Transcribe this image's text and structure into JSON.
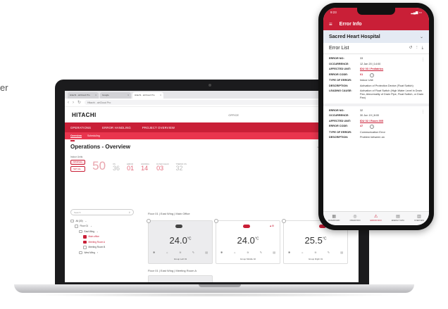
{
  "crop_text": "er",
  "laptop": {
    "browser": {
      "tabs": [
        {
          "label": "Hitachi - airCloud Pro",
          "active": false
        },
        {
          "label": "Google",
          "active": false
        },
        {
          "label": "Hitachi - airCloud Pro",
          "active": true
        }
      ],
      "address": "Hitachi - airCloud Pro"
    },
    "brand": "HITACHI",
    "office_label": "OFFICE",
    "menu": [
      "OPERATIONS",
      "ERROR HANDLING",
      "PROJECT OVERVIEW"
    ],
    "submenu": [
      "Overview",
      "Scheduling"
    ],
    "page_title": "Operations - Overview",
    "last_update": "Last Updated on 10:50 May 20, 2020",
    "indoor_units_label": "Indoor Units",
    "pills": [
      "STOP ALL",
      "SET ALL"
    ],
    "total_units": "50",
    "stats": [
      {
        "label": "ON",
        "value": "36"
      },
      {
        "label": "ERROR",
        "value": "01"
      },
      {
        "label": "WARNING",
        "value": "14"
      },
      {
        "label": "FILTER CLEAN",
        "value": "03"
      },
      {
        "label": "THERMO ON",
        "value": "32"
      }
    ],
    "search_placeholder": "Search",
    "tree": [
      {
        "label": "All (30)",
        "level": 0,
        "checked": false,
        "red": false
      },
      {
        "label": "Floor 01",
        "level": 1,
        "checked": false,
        "red": false
      },
      {
        "label": "East Wing",
        "level": 2,
        "checked": false,
        "red": false
      },
      {
        "label": "Main office",
        "level": 3,
        "checked": true,
        "red": true
      },
      {
        "label": "Meeting Room A",
        "level": 3,
        "checked": true,
        "red": true
      },
      {
        "label": "Meeting Room B",
        "level": 3,
        "checked": false,
        "red": false
      },
      {
        "label": "West Wing",
        "level": 2,
        "checked": false,
        "red": false
      }
    ],
    "breadcrumb1": "Floor 01  |  East Wing  |  Main Office",
    "breadcrumb2": "Floor 01  |  East Wing  |  Meeting Room A",
    "units": [
      {
        "temp": "24.0",
        "unit": "°C",
        "group": "Group Left",
        "count": "01",
        "tag": ""
      },
      {
        "temp": "24.0",
        "unit": "°C",
        "group": "Group Middle",
        "count": "02",
        "tag": ""
      },
      {
        "temp": "25.5",
        "unit": "°C",
        "group": "Group Right",
        "count": "01",
        "tag": "Heat"
      }
    ]
  },
  "phone": {
    "time": "9:23",
    "title": "Error Info",
    "hospital": "Sacred Heart Hospital",
    "list_title": "Error List",
    "errors": [
      {
        "error_no": "33",
        "occurrence": "12 Jan 20  |  14:00",
        "affected_unit": "IDU 03 / Pediatrics",
        "error_code": "01",
        "type": "Indoor Unit",
        "description": "Activation of Protection Device (Float Switch)",
        "leading_cause": "Activation of Float Switch (High Water Level in Drain Pan, Abnormality of Drain Pipe, Float Switch, or Drain Pan)"
      },
      {
        "error_no": "32",
        "occurrence": "30 Jun 19  |  8:00",
        "affected_unit": "IDU 02 / Room 005",
        "error_code": "47",
        "type": "Communication Error",
        "description": "Problem between an"
      }
    ],
    "labels": {
      "error_no": "ERROR NO:",
      "occurrence": "OCCURRENCE:",
      "affected_unit": "AFFECTED UNIT:",
      "error_code": "ERROR CODE:",
      "type": "TYPE OF ERROR:",
      "description": "DESCRIPTION:",
      "leading_cause": "LEADING CAUSE:"
    },
    "nav": [
      "DASHBOARD",
      "OPERATION",
      "ERROR INFO",
      "ENERGY DATA",
      "OVERVIEW"
    ]
  }
}
